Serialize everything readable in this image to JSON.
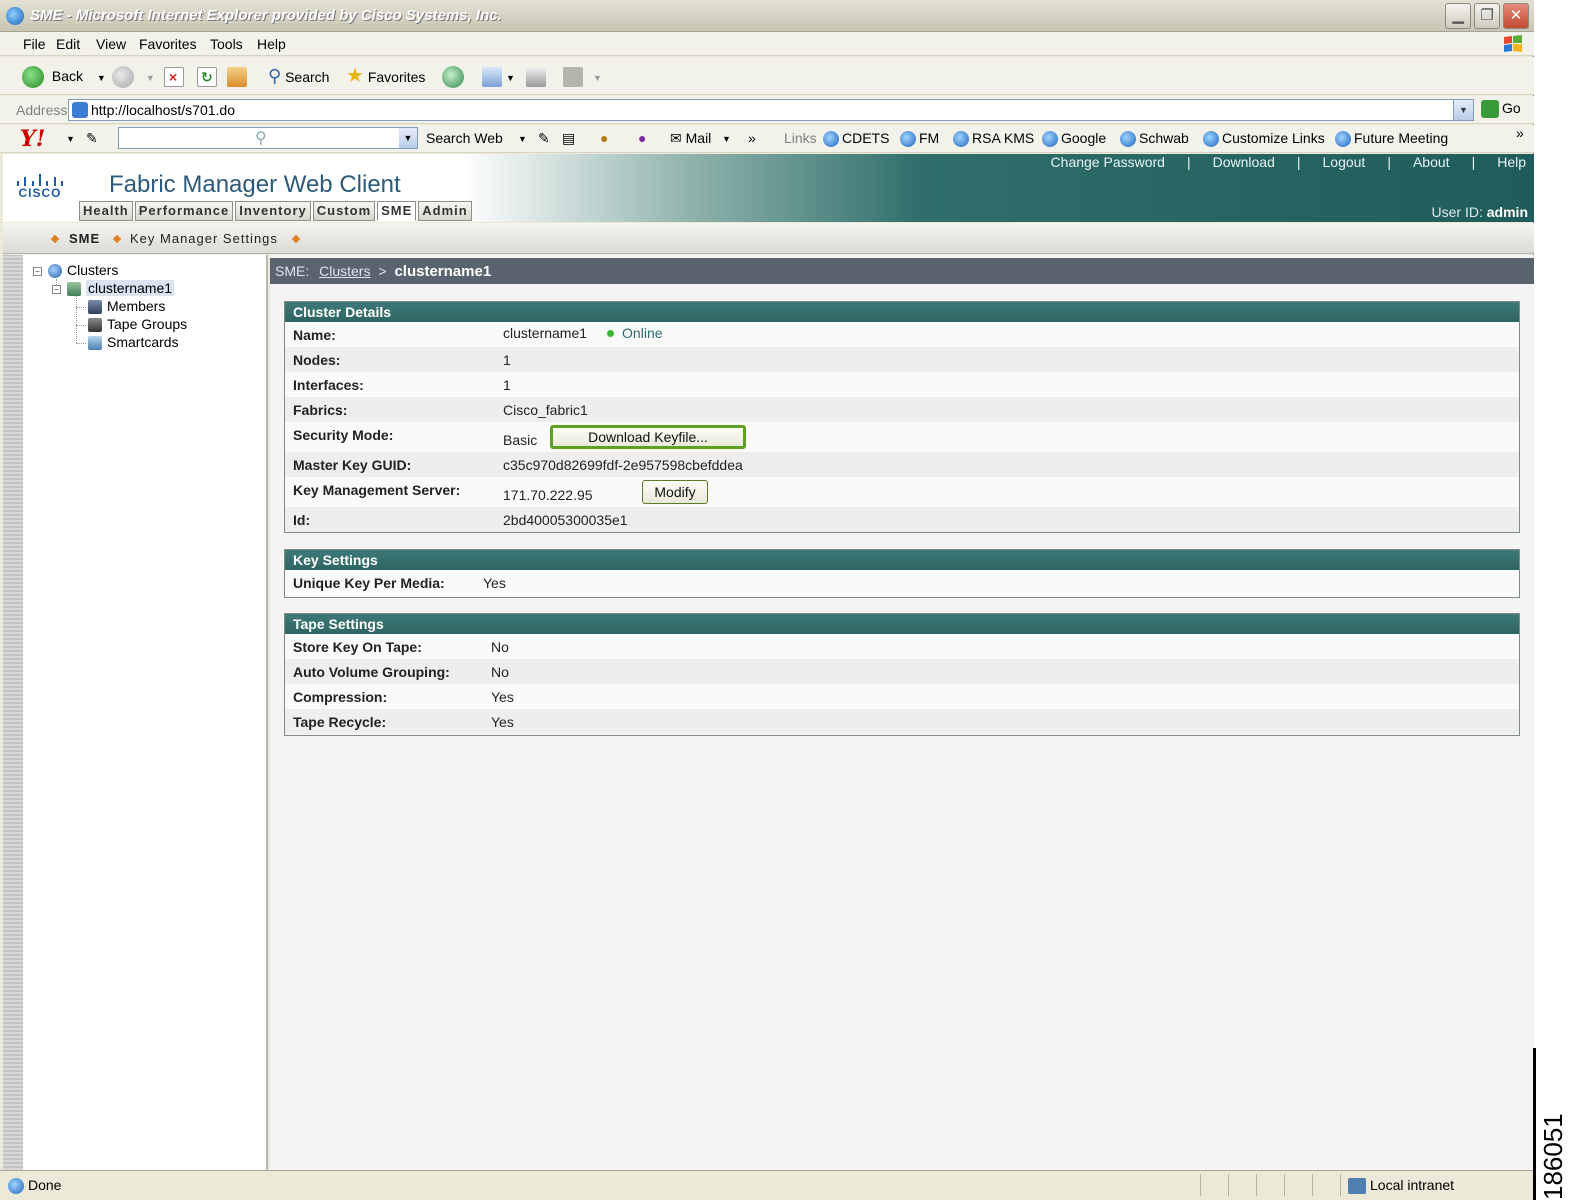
{
  "window": {
    "title": "SME - Microsoft Internet Explorer provided by Cisco Systems, Inc.",
    "minimize_glyph": "▁",
    "maximize_glyph": "❐",
    "close_glyph": "✕"
  },
  "menu": [
    "File",
    "Edit",
    "View",
    "Favorites",
    "Tools",
    "Help"
  ],
  "toolbar": {
    "back": "Back",
    "search": "Search",
    "favorites": "Favorites"
  },
  "address": {
    "label": "Address",
    "url": "http://localhost/s701.do",
    "go": "Go"
  },
  "linksbar": {
    "search_web": "Search Web",
    "mail": "Mail",
    "more": "»",
    "links_label": "Links",
    "links": [
      "CDETS",
      "FM",
      "RSA KMS",
      "Google",
      "Schwab",
      "Customize Links",
      "Future Meeting"
    ]
  },
  "app": {
    "title": "Fabric Manager Web Client",
    "logo_text": "CISCO",
    "tabs": [
      "Health",
      "Performance",
      "Inventory",
      "Custom",
      "SME",
      "Admin"
    ],
    "active_tab": "SME",
    "top_links": [
      "Change Password",
      "Download",
      "Logout",
      "About",
      "Help"
    ],
    "top_sep": "|",
    "user_id_label": "User ID:",
    "user_id": "admin"
  },
  "subnav": {
    "items": [
      "SME",
      "Key Manager Settings"
    ]
  },
  "tree": {
    "root": "Clusters",
    "cluster": "clustername1",
    "children": [
      "Members",
      "Tape Groups",
      "Smartcards"
    ]
  },
  "breadcrumb": {
    "prefix": "SME:",
    "link": "Clusters",
    "sep": ">",
    "current": "clustername1"
  },
  "cluster_details": {
    "header": "Cluster Details",
    "name_label": "Name:",
    "name_value": "clustername1",
    "status": "Online",
    "nodes_label": "Nodes:",
    "nodes_value": "1",
    "interfaces_label": "Interfaces:",
    "interfaces_value": "1",
    "fabrics_label": "Fabrics:",
    "fabrics_value": "Cisco_fabric1",
    "security_label": "Security Mode:",
    "security_value": "Basic",
    "download_keyfile": "Download Keyfile...",
    "guid_label": "Master Key GUID:",
    "guid_value": "c35c970d82699fdf-2e957598cbefddea",
    "kms_label": "Key Management Server:",
    "kms_value": "171.70.222.95",
    "modify": "Modify",
    "id_label": "Id:",
    "id_value": "2bd40005300035e1"
  },
  "key_settings": {
    "header": "Key Settings",
    "unique_label": "Unique Key Per Media:",
    "unique_value": "Yes"
  },
  "tape_settings": {
    "header": "Tape Settings",
    "store_label": "Store Key On Tape:",
    "store_value": "No",
    "auto_label": "Auto Volume Grouping:",
    "auto_value": "No",
    "compression_label": "Compression:",
    "compression_value": "Yes",
    "recycle_label": "Tape Recycle:",
    "recycle_value": "Yes"
  },
  "statusbar": {
    "status": "Done",
    "zone": "Local intranet"
  },
  "figure_number": "186051"
}
